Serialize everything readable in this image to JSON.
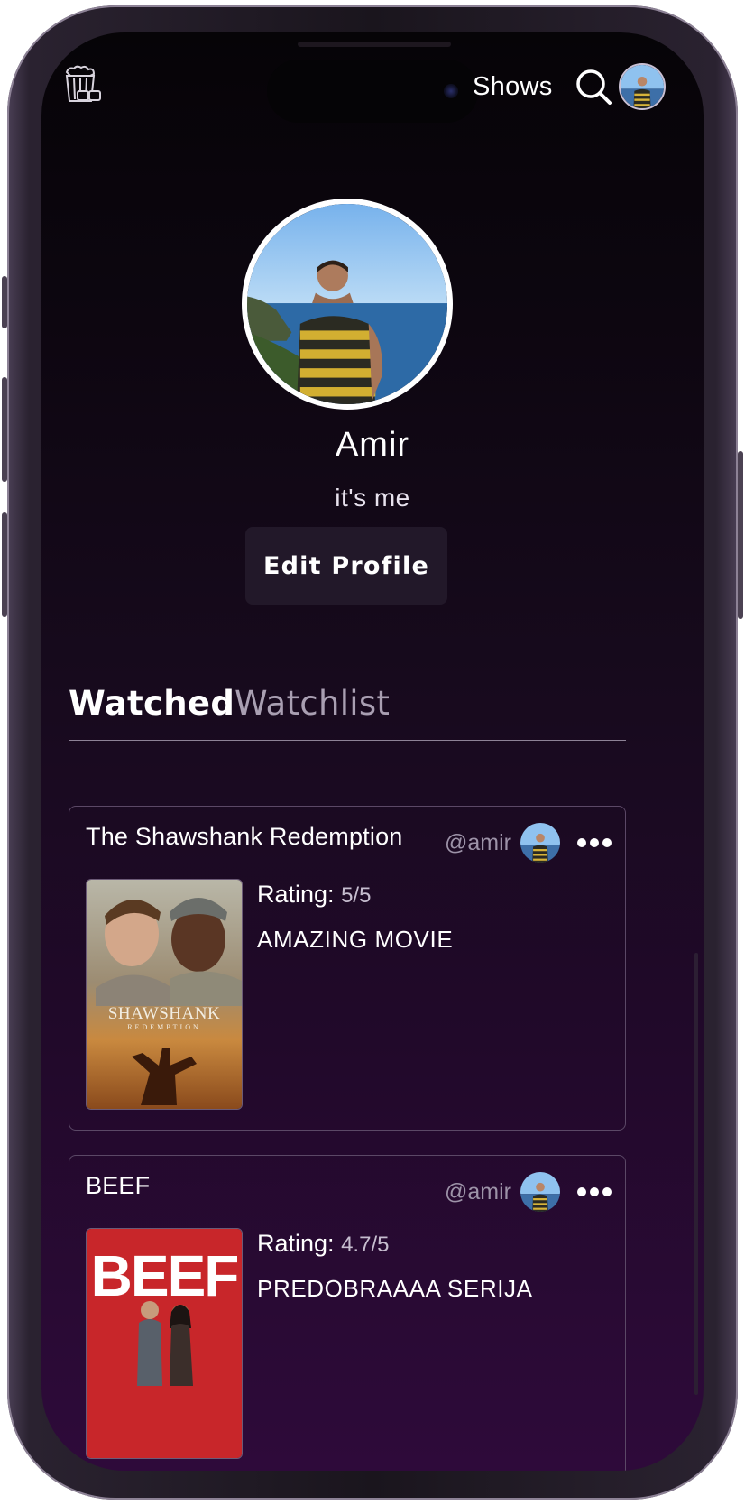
{
  "nav": {
    "logo_icon": "popcorn-3d-glasses-icon",
    "shows_label": "Shows",
    "search_icon": "search-icon"
  },
  "profile": {
    "name": "Amir",
    "bio": "it's me",
    "edit_label": "Edit Profile"
  },
  "tabs": [
    {
      "label": "Watched",
      "active": true
    },
    {
      "label": "Watchlist",
      "active": false
    }
  ],
  "reviews": [
    {
      "title": "The Shawshank Redemption",
      "user": "@amir",
      "rating_label": "Rating:",
      "rating_value": "5/5",
      "review": "AMAZING MOVIE",
      "poster_text": "SHAWSHANK",
      "poster_sub": "REDEMPTION"
    },
    {
      "title": "BEEF",
      "user": "@amir",
      "rating_label": "Rating:",
      "rating_value": "4.7/5",
      "review": "PREDOBRAAAA SERIJA",
      "poster_text": "BEEF"
    }
  ],
  "colors": {
    "background_top": "#060407",
    "background_bottom": "#2e0a3a",
    "card_border": "#5b4866",
    "button_bg": "#221829"
  }
}
